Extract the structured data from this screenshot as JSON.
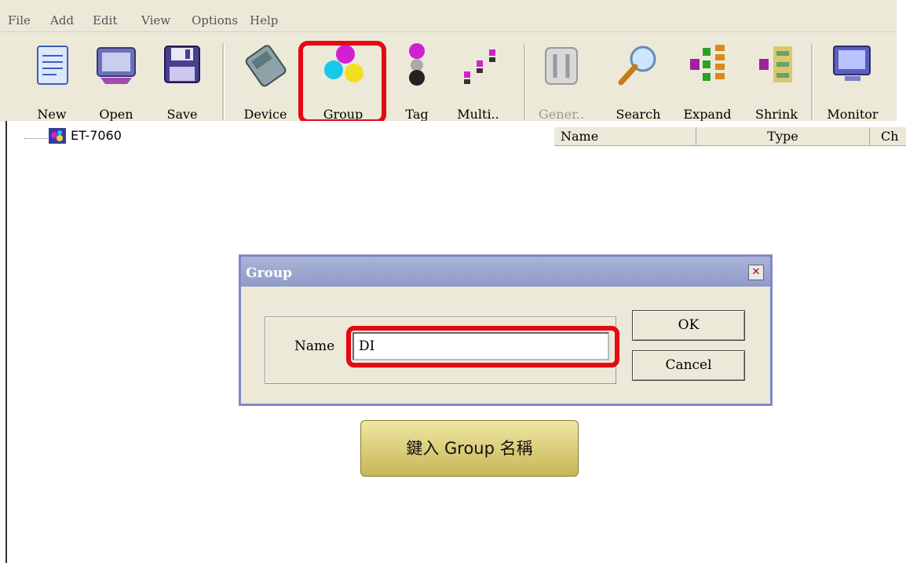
{
  "menu": {
    "file": "File",
    "add": "Add",
    "edit": "Edit",
    "view": "View",
    "options": "Options",
    "help": "Help"
  },
  "toolbar": {
    "new": "New",
    "open": "Open",
    "save": "Save",
    "device": "Device",
    "group": "Group",
    "tag": "Tag",
    "multi": "Multi..",
    "general": "Gener..",
    "search": "Search",
    "expand": "Expand",
    "shrink": "Shrink",
    "monitor": "Monitor"
  },
  "tree": {
    "root_label": "ET-7060"
  },
  "list": {
    "col_name": "Name",
    "col_type": "Type",
    "col_ch": "Ch"
  },
  "dialog": {
    "title": "Group",
    "name_label": "Name",
    "name_value": "DI",
    "ok_label": "OK",
    "cancel_label": "Cancel"
  },
  "callout": {
    "text": "鍵入 Group 名稱"
  },
  "colors": {
    "highlight": "#e50914",
    "callout_bg": "#d8ca70",
    "dialog_border": "#7d8ac8"
  }
}
